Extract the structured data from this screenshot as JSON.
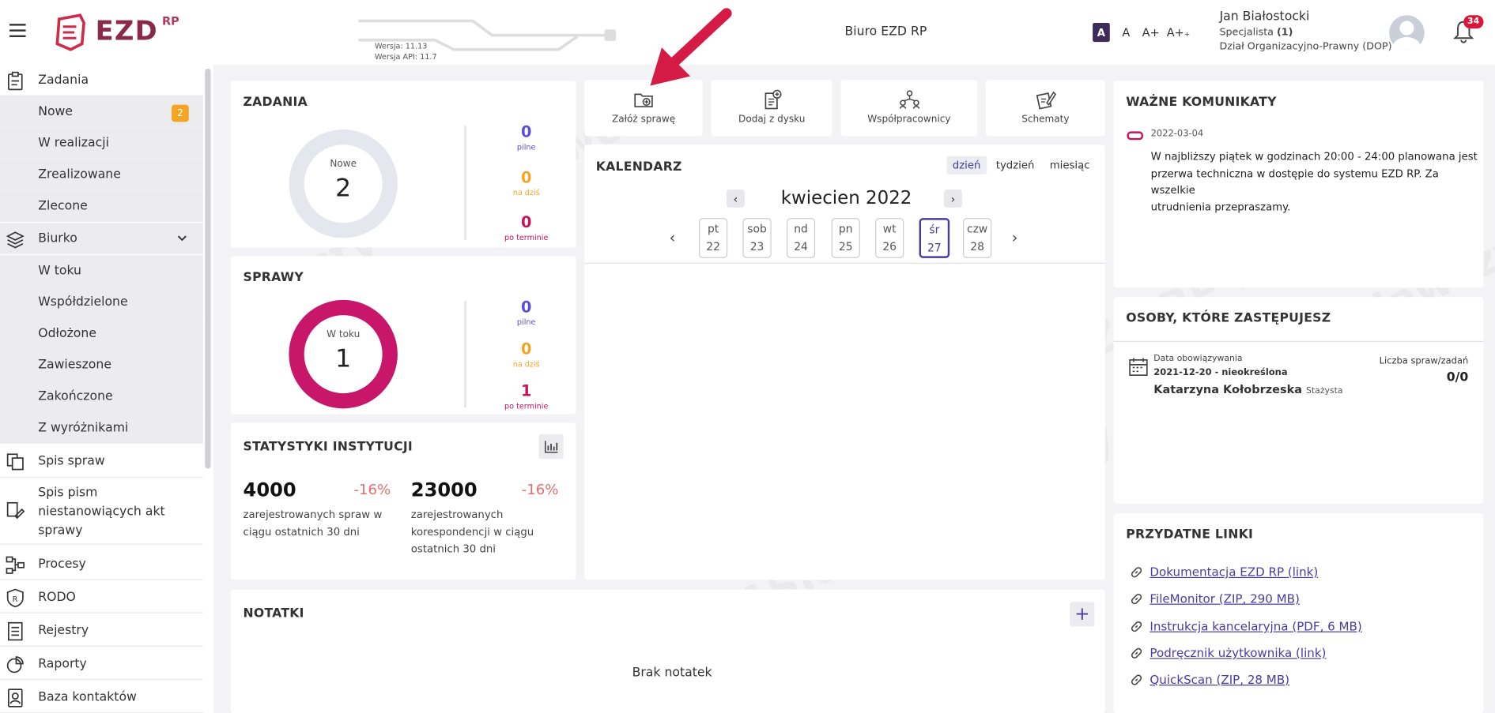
{
  "header": {
    "logo_text": "EZD",
    "logo_sup": "RP",
    "version": "Wersja: 11.13",
    "api_version": "Wersja API: 11.7",
    "office": "Biuro EZD RP",
    "font_sizes": [
      "A",
      "A",
      "A+",
      "A+₊"
    ],
    "user_name": "Jan Białostocki",
    "user_role_prefix": "Specjalista ",
    "user_role_count": "(1)",
    "user_dept": "Dział Organizacyjno-Prawny (DOP)",
    "notifications": "34"
  },
  "sidebar": {
    "zadania": "Zadania",
    "nowe": "Nowe",
    "nowe_count": "2",
    "w_realizacji": "W realizacji",
    "zrealizowane": "Zrealizowane",
    "zlecone": "Zlecone",
    "biurko": "Biurko",
    "w_toku": "W toku",
    "wspoldzielone": "Współdzielone",
    "odlozone": "Odłożone",
    "zawieszone": "Zawieszone",
    "zakonczone": "Zakończone",
    "z_wyroznikami": "Z wyróżnikami",
    "spis_spraw": "Spis spraw",
    "spis_pism_1": "Spis pism",
    "spis_pism_2": "niestanowiących akt",
    "spis_pism_3": "sprawy",
    "procesy": "Procesy",
    "rodo": "RODO",
    "rejestry": "Rejestry",
    "raporty": "Raporty",
    "baza": "Baza kontaktów"
  },
  "zadania": {
    "title": "ZADANIA",
    "donut_label": "Nowe",
    "donut_value": "2",
    "pilne": "0",
    "pilne_lbl": "pilne",
    "na_dzis": "0",
    "na_dzis_lbl": "na dziś",
    "po_terminie": "0",
    "po_terminie_lbl": "po terminie"
  },
  "sprawy": {
    "title": "SPRAWY",
    "donut_label": "W toku",
    "donut_value": "1",
    "pilne": "0",
    "pilne_lbl": "pilne",
    "na_dzis": "0",
    "na_dzis_lbl": "na dziś",
    "po_terminie": "1",
    "po_terminie_lbl": "po terminie"
  },
  "stats": {
    "title": "STATYSTYKI INSTYTUCJI",
    "v1": "4000",
    "p1": "-16%",
    "d1_1": "zarejestrowanych spraw w",
    "d1_2": "ciągu ostatnich 30 dni",
    "v2": "23000",
    "p2": "-16%",
    "d2_1": "zarejestrowanych",
    "d2_2": "korespondencji w ciągu",
    "d2_3": "ostatnich 30 dni"
  },
  "quick": {
    "zaloz": "Załóż sprawę",
    "dodaj": "Dodaj z dysku",
    "wspol": "Współpracownicy",
    "schematy": "Schematy"
  },
  "calendar": {
    "title": "KALENDARZ",
    "tab_day": "dzień",
    "tab_week": "tydzień",
    "tab_month": "miesiąc",
    "month": "kwiecien 2022",
    "days": [
      {
        "d": "pt",
        "n": "22"
      },
      {
        "d": "sob",
        "n": "23"
      },
      {
        "d": "nd",
        "n": "24"
      },
      {
        "d": "pn",
        "n": "25"
      },
      {
        "d": "wt",
        "n": "26"
      },
      {
        "d": "śr",
        "n": "27"
      },
      {
        "d": "czw",
        "n": "28"
      }
    ]
  },
  "notatki": {
    "title": "NOTATKI",
    "empty": "Brak notatek"
  },
  "komunikaty": {
    "title": "WAŻNE KOMUNIKATY",
    "date": "2022-03-04",
    "line1": "W najbliższy piątek w godzinach 20:00 - 24:00 planowana jest",
    "line2": "przerwa techniczna w dostępie do systemu EZD RP. Za wszelkie",
    "line3": "utrudnienia przepraszamy."
  },
  "osoby": {
    "title": "OSOBY, KTÓRE ZASTĘPUJESZ",
    "date_lbl": "Data obowiązywania",
    "date_val": "2021-12-20 - nieokreślona",
    "count_lbl": "Liczba spraw/zadań",
    "count_val": "0/0",
    "person": "Katarzyna Kołobrzeska",
    "person_role": "Stażysta"
  },
  "linki": {
    "title": "PRZYDATNE LINKI",
    "l1": "Dokumentacja EZD RP (link)",
    "l2": "FileMonitor (ZIP, 290 MB)",
    "l3": "Instrukcja kancelaryjna (PDF, 6 MB)",
    "l4": "Podręcznik użytkownika (link)",
    "l5": "QuickScan (ZIP, 28 MB)"
  },
  "colors": {
    "accent": "#4a3ba0",
    "brand": "#8a2a4a",
    "pilne": "#5b4fd8",
    "na_dzis": "#f5a524",
    "po_terminie": "#c4145c",
    "arrow": "#d41a45"
  }
}
